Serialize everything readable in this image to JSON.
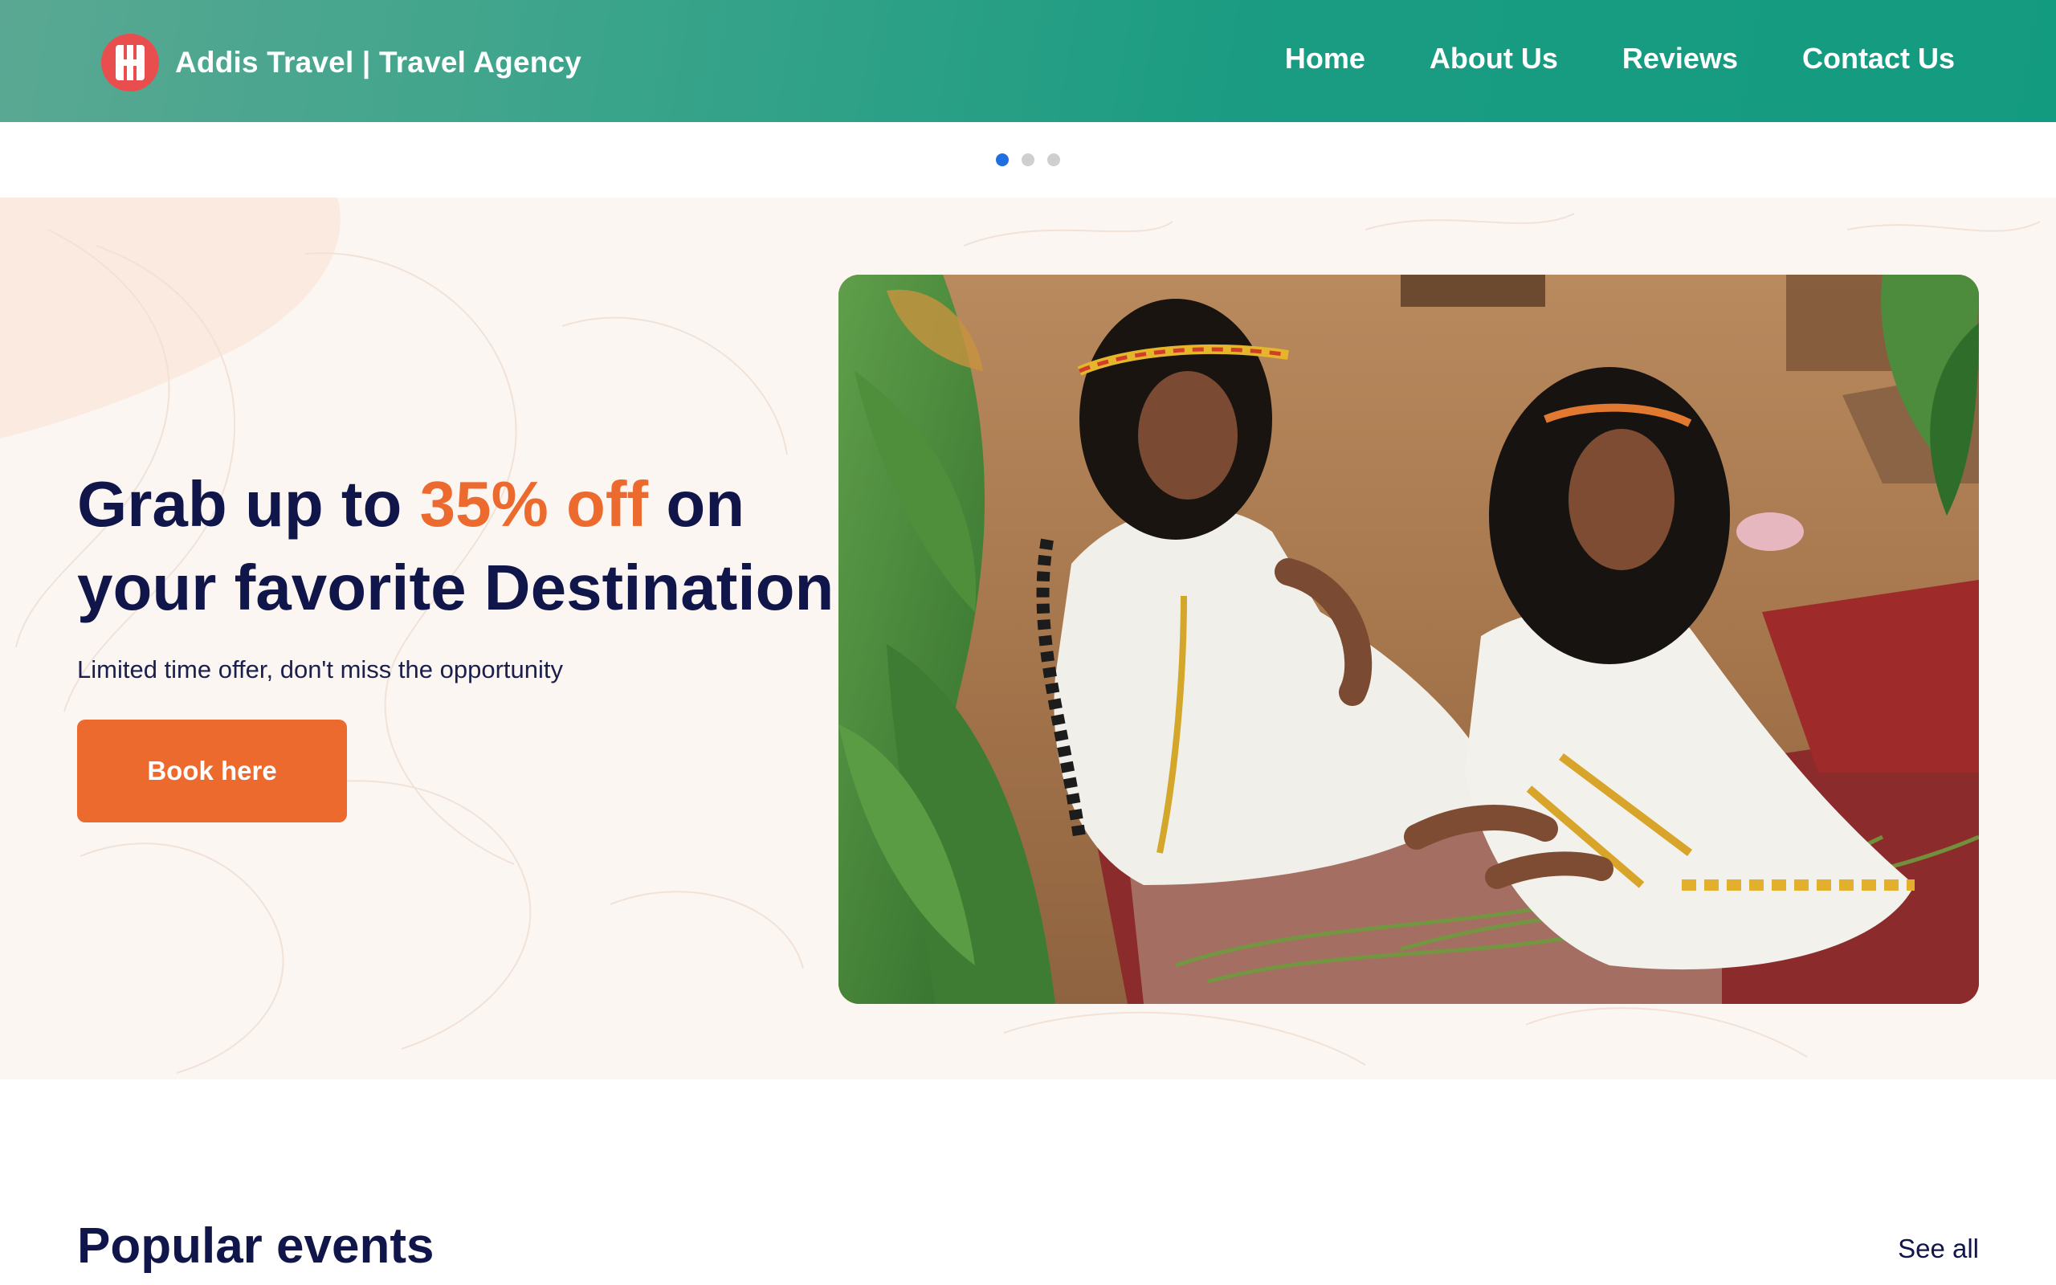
{
  "brand": {
    "name": "Addis Travel | Travel Agency",
    "logo_icon": "building-logo-icon"
  },
  "nav": {
    "items": [
      {
        "label": "Home"
      },
      {
        "label": "About Us"
      },
      {
        "label": "Reviews"
      },
      {
        "label": "Contact Us"
      }
    ]
  },
  "carousel": {
    "slide_count": 3,
    "active_slide": 1
  },
  "hero": {
    "title_prefix": "Grab up to ",
    "title_accent": "35% off",
    "title_suffix": " on your favorite Destination",
    "subtitle": "Limited time offer, don't miss the opportunity",
    "cta_label": "Book here",
    "image_subject": "two women in traditional white Ethiopian dresses seated on a patterned rug"
  },
  "events": {
    "title": "Popular events",
    "see_all_label": "See all"
  },
  "colors": {
    "nav_gradient_start": "#5aa893",
    "nav_gradient_end": "#139b80",
    "accent_orange": "#ec6a2d",
    "heading_navy": "#11164a",
    "hero_background": "#fcf6f2",
    "active_dot": "#1f6fe0",
    "inactive_dot": "#cfcfcf"
  }
}
